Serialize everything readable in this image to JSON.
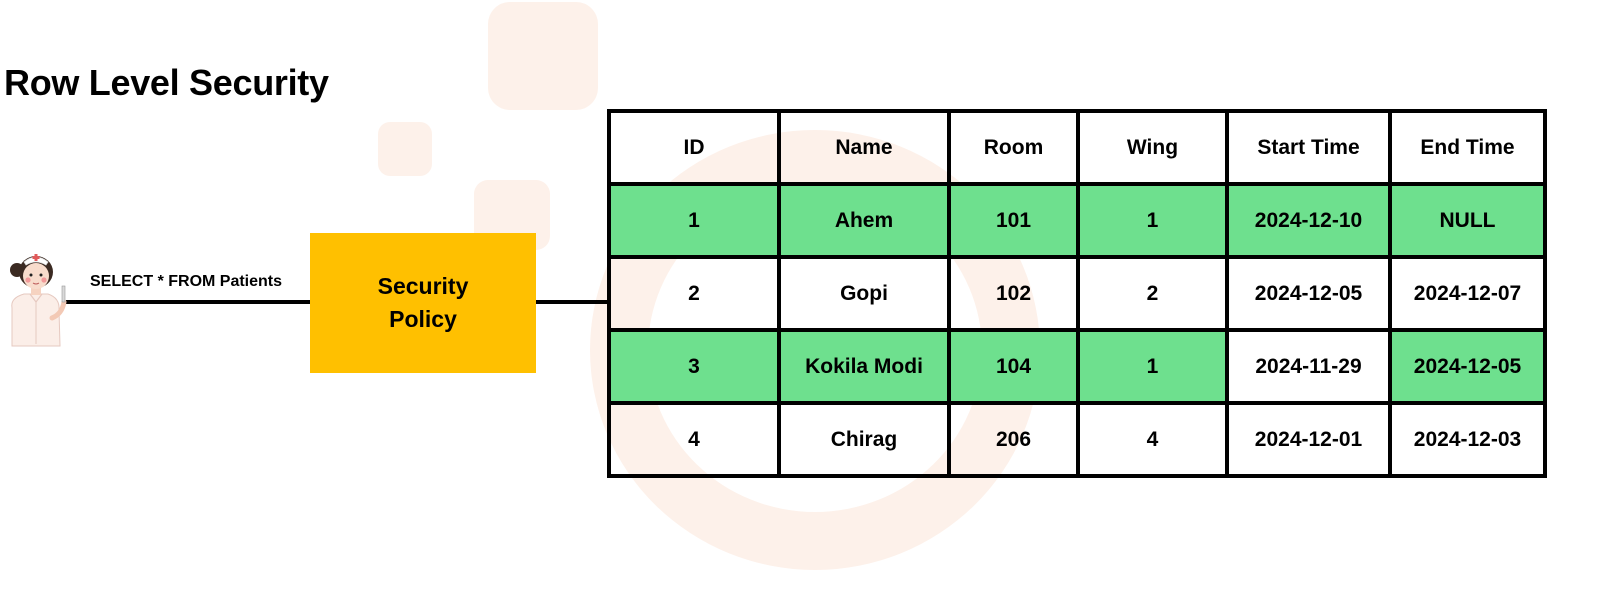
{
  "title": "Row Level Security",
  "user": {
    "icon": "nurse-icon",
    "query": "SELECT * FROM Patients"
  },
  "policy": {
    "line1": "Security",
    "line2": "Policy"
  },
  "colors": {
    "policy_fill": "#ffc000",
    "allowed_row_fill": "#6ee08e",
    "border": "#000000"
  },
  "table": {
    "headers": [
      "ID",
      "Name",
      "Room",
      "Wing",
      "Start Time",
      "End Time"
    ],
    "rows": [
      {
        "cells": [
          "1",
          "Ahem",
          "101",
          "1",
          "2024-12-10",
          "NULL"
        ],
        "highlighted": [
          true,
          true,
          true,
          true,
          true,
          true
        ]
      },
      {
        "cells": [
          "2",
          "Gopi",
          "102",
          "2",
          "2024-12-05",
          "2024-12-07"
        ],
        "highlighted": [
          false,
          false,
          false,
          false,
          false,
          false
        ]
      },
      {
        "cells": [
          "3",
          "Kokila Modi",
          "104",
          "1",
          "2024-11-29",
          "2024-12-05"
        ],
        "highlighted": [
          true,
          true,
          true,
          true,
          false,
          true
        ]
      },
      {
        "cells": [
          "4",
          "Chirag",
          "206",
          "4",
          "2024-12-01",
          "2024-12-03"
        ],
        "highlighted": [
          false,
          false,
          false,
          false,
          false,
          false
        ]
      }
    ]
  }
}
